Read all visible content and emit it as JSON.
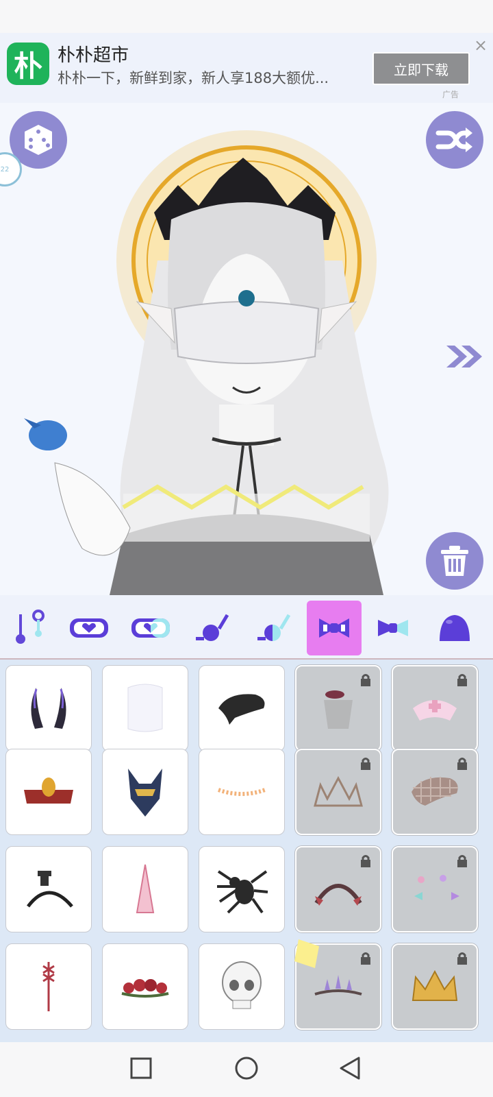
{
  "ad": {
    "logo_char": "朴",
    "title": "朴朴超市",
    "description": "朴朴一下，新鲜到家，新人享188大额优...",
    "button_label": "立即下载",
    "close_icon": "×",
    "ad_label": "广告"
  },
  "canvas": {
    "left_badge": "22"
  },
  "colors": {
    "accent_purple": "#8f8ad1",
    "active_tab": "#e77df0",
    "locked_tile": "#c8cbce"
  },
  "tabs": [
    {
      "icon": "earrings-icon"
    },
    {
      "icon": "heart-mask-icon"
    },
    {
      "icon": "half-mask-icon"
    },
    {
      "icon": "monocle-icon"
    },
    {
      "icon": "monocle-half-icon"
    },
    {
      "icon": "bow-icon",
      "active": true
    },
    {
      "icon": "bow-small-icon"
    },
    {
      "icon": "hat-icon"
    }
  ],
  "items": [
    {
      "icon": "horns-icon",
      "locked": false
    },
    {
      "icon": "veil-icon",
      "locked": false
    },
    {
      "icon": "beret-icon",
      "locked": false
    },
    {
      "icon": "fascinator-icon",
      "locked": true
    },
    {
      "icon": "nurse-cap-icon",
      "locked": true
    },
    {
      "icon": "cobra-crown-icon",
      "locked": false
    },
    {
      "icon": "anubis-mask-icon",
      "locked": false
    },
    {
      "icon": "glitter-band-icon",
      "locked": false
    },
    {
      "icon": "tiara-icon",
      "locked": true
    },
    {
      "icon": "plaid-beret-icon",
      "locked": true
    },
    {
      "icon": "rook-headband-icon",
      "locked": false
    },
    {
      "icon": "unicorn-horn-icon",
      "locked": false
    },
    {
      "icon": "spider-icon",
      "locked": false
    },
    {
      "icon": "lace-headband-icon",
      "locked": true
    },
    {
      "icon": "bows-clips-icon",
      "locked": true
    },
    {
      "icon": "ribbon-icon",
      "locked": false
    },
    {
      "icon": "rose-crown-icon",
      "locked": false
    },
    {
      "icon": "skull-icon",
      "locked": false
    },
    {
      "icon": "crystal-tiara-icon",
      "locked": true
    },
    {
      "icon": "gold-crown-icon",
      "locked": true
    }
  ]
}
